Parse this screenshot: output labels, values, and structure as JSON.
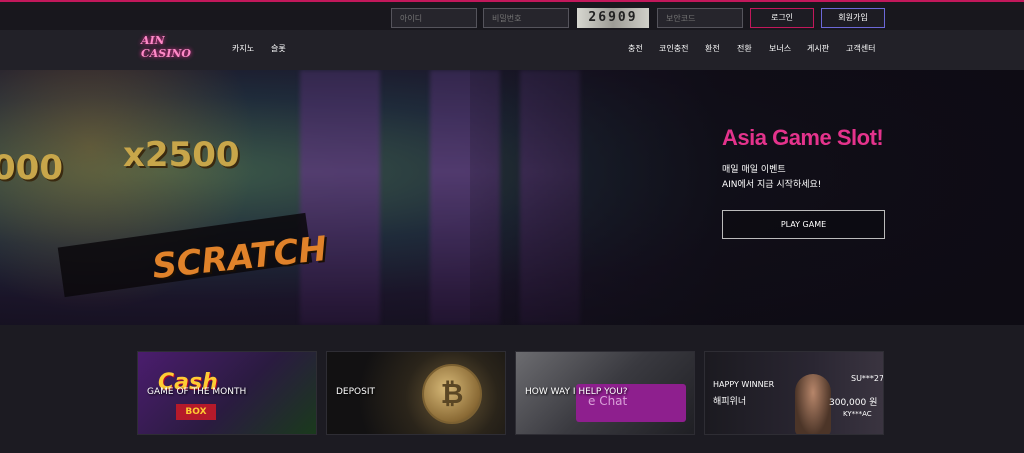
{
  "topbar": {
    "id_placeholder": "아이디",
    "pw_placeholder": "비밀번호",
    "captcha": "26909",
    "code_placeholder": "보안코드",
    "login": "로그인",
    "join": "회원가입"
  },
  "nav": {
    "logo_line1": "AIN",
    "logo_line2": "CASINO",
    "left": [
      "카지노",
      "슬롯"
    ],
    "right": [
      "충전",
      "코인충전",
      "환전",
      "전환",
      "보너스",
      "게시판",
      "고객센터"
    ]
  },
  "hero": {
    "multiplier": "x2500",
    "partial_number": "000",
    "scratch": "SCRATCH",
    "title": "Asia Game Slot!",
    "line1": "매일 매일 이벤트",
    "line2": "AIN에서 지금 시작하세요!",
    "button": "PLAY GAME"
  },
  "cards": {
    "game": "GAME OF THE MONTH",
    "game_art": "Cash",
    "game_box": "BOX",
    "deposit": "DEPOSIT",
    "coin_symbol": "₿",
    "help": "HOW WAY I HELP YOU?",
    "help_key": "e Chat",
    "winner_en": "HAPPY WINNER",
    "winner_ko": "해피위너",
    "winner_name": "SU***27",
    "winner_amount": "300,000 원",
    "winner_name2": "KY***AC"
  },
  "colors": {
    "accent": "#e4338c",
    "join_border": "#6c68d8",
    "login_border": "#c2185b"
  }
}
